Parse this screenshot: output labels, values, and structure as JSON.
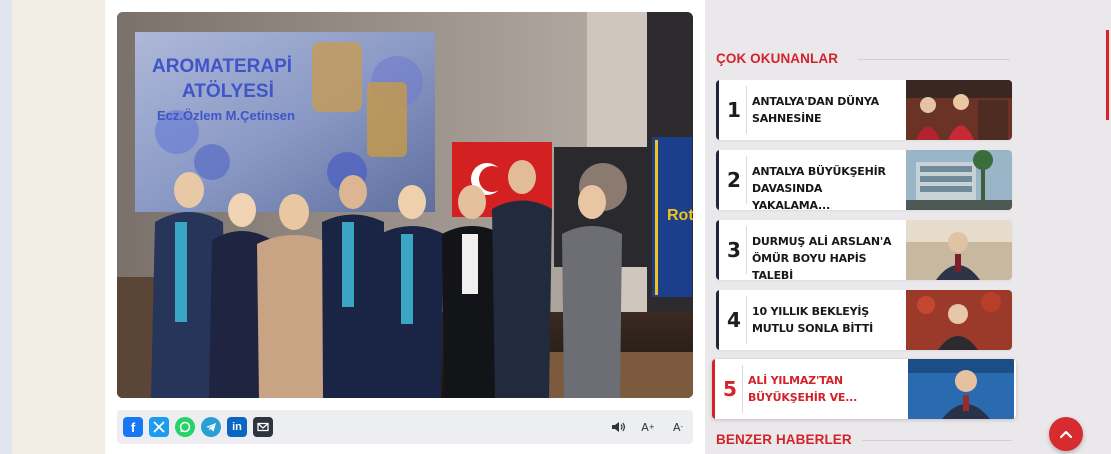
{
  "article": {
    "photo_alt": "Group photo at aromatherapy workshop",
    "screen_title_line1": "AROMATERAPİ",
    "screen_title_line2": "ATÖLYESİ",
    "screen_subtitle": "Ecz.Özlem M.Çetinsen",
    "banner_text": "Rot",
    "share": [
      {
        "name": "facebook",
        "icon": "facebook-icon",
        "glyph": "f",
        "color": "#1877f2"
      },
      {
        "name": "x",
        "icon": "x-icon",
        "glyph": "𝕏",
        "color": "#1d9bf0"
      },
      {
        "name": "whatsapp",
        "icon": "whatsapp-icon",
        "glyph": "",
        "color": "#25d366"
      },
      {
        "name": "telegram",
        "icon": "telegram-icon",
        "glyph": "",
        "color": "#2a9fd6"
      },
      {
        "name": "linkedin",
        "icon": "linkedin-icon",
        "glyph": "in",
        "color": "#0a66c2"
      },
      {
        "name": "email",
        "icon": "email-icon",
        "glyph": "",
        "color": "#2d3440"
      }
    ],
    "tools": {
      "font_increase": "A",
      "font_increase_sup": "+",
      "font_decrease": "A",
      "font_decrease_sup": "-"
    }
  },
  "sidebar": {
    "most_read_title": "ÇOK OKUNANLAR",
    "related_title": "BENZER HABERLER",
    "items": [
      {
        "rank": "1",
        "title": "ANTALYA'DAN DÜNYA SAHNESİNE"
      },
      {
        "rank": "2",
        "title": "ANTALYA BÜYÜKŞEHİR DAVASINDA YAKALAMA..."
      },
      {
        "rank": "3",
        "title": "DURMUŞ ALİ ARSLAN'A ÖMÜR BOYU HAPİS TALEBİ"
      },
      {
        "rank": "4",
        "title": "10 YILLIK BEKLEYİŞ MUTLU SONLA BİTTİ"
      },
      {
        "rank": "5",
        "title": "ALİ YILMAZ'TAN BÜYÜKŞEHİR VE..."
      }
    ]
  },
  "colors": {
    "accent": "#d3232a",
    "rank_text": "#1d1d1f"
  }
}
